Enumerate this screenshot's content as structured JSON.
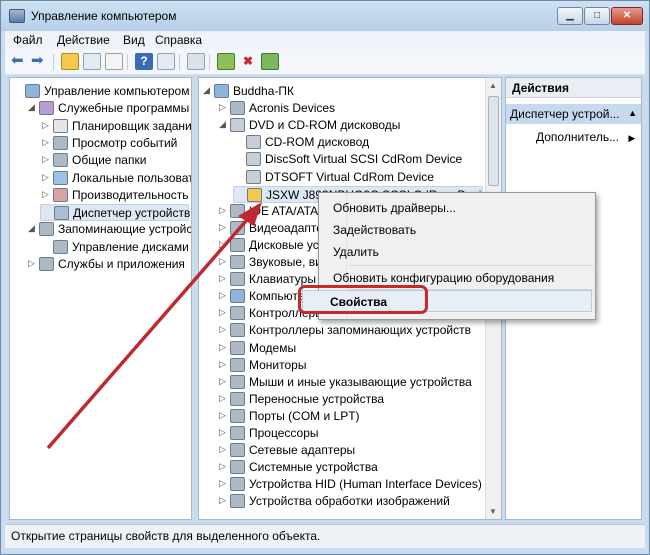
{
  "window": {
    "title": "Управление компьютером"
  },
  "menu": [
    "Файл",
    "Действие",
    "Вид",
    "Справка"
  ],
  "left_tree": [
    {
      "label": "Управление компьютером (л",
      "depth": 0,
      "exp": "",
      "icon": "computer-icon"
    },
    {
      "label": "Служебные программы",
      "depth": 1,
      "exp": "◢",
      "icon": "tools-icon"
    },
    {
      "label": "Планировщик заданий",
      "depth": 2,
      "exp": "▷",
      "icon": "clock-icon"
    },
    {
      "label": "Просмотр событий",
      "depth": 2,
      "exp": "▷",
      "icon": "event-viewer-icon"
    },
    {
      "label": "Общие папки",
      "depth": 2,
      "exp": "▷",
      "icon": "shared-folders-icon"
    },
    {
      "label": "Локальные пользовате",
      "depth": 2,
      "exp": "▷",
      "icon": "users-icon"
    },
    {
      "label": "Производительность",
      "depth": 2,
      "exp": "▷",
      "icon": "performance-icon"
    },
    {
      "label": "Диспетчер устройств",
      "depth": 2,
      "exp": "",
      "icon": "device-manager-icon",
      "selected": true
    },
    {
      "label": "Запоминающие устройства",
      "depth": 1,
      "exp": "◢",
      "icon": "storage-icon"
    },
    {
      "label": "Управление дисками",
      "depth": 2,
      "exp": "",
      "icon": "disk-management-icon"
    },
    {
      "label": "Службы и приложения",
      "depth": 1,
      "exp": "▷",
      "icon": "services-icon"
    }
  ],
  "device_tree": [
    {
      "label": "Buddha-ПК",
      "depth": 0,
      "exp": "◢",
      "icon": "computer-icon"
    },
    {
      "label": "Acronis Devices",
      "depth": 1,
      "exp": "▷",
      "icon": "device-icon"
    },
    {
      "label": "DVD и CD-ROM дисководы",
      "depth": 1,
      "exp": "◢",
      "icon": "dvd-drive-icon"
    },
    {
      "label": "CD-ROM дисковод",
      "depth": 2,
      "exp": "",
      "icon": "dvd-drive-icon"
    },
    {
      "label": "DiscSoft Virtual SCSI CdRom Device",
      "depth": 2,
      "exp": "",
      "icon": "dvd-drive-icon"
    },
    {
      "label": "DTSOFT Virtual CdRom Device",
      "depth": 2,
      "exp": "",
      "icon": "dvd-drive-icon"
    },
    {
      "label": "JSXW J893NBHO2C SCSI CdRom Device",
      "depth": 2,
      "exp": "",
      "icon": "warning-drive-icon",
      "selected": true
    },
    {
      "label": "IDE ATA/ATAPI контроллеры",
      "depth": 1,
      "exp": "▷",
      "icon": "controller-icon"
    },
    {
      "label": "Видеоадаптеры",
      "depth": 1,
      "exp": "▷",
      "icon": "display-adapter-icon"
    },
    {
      "label": "Дисковые устройства",
      "depth": 1,
      "exp": "▷",
      "icon": "disk-drive-icon"
    },
    {
      "label": "Звуковые, видео и игровые устройства",
      "depth": 1,
      "exp": "▷",
      "icon": "sound-icon"
    },
    {
      "label": "Клавиатуры",
      "depth": 1,
      "exp": "▷",
      "icon": "keyboard-icon"
    },
    {
      "label": "Компьютер",
      "depth": 1,
      "exp": "▷",
      "icon": "computer-icon"
    },
    {
      "label": "Контроллеры USB",
      "depth": 1,
      "exp": "▷",
      "icon": "usb-icon"
    },
    {
      "label": "Контроллеры запоминающих устройств",
      "depth": 1,
      "exp": "▷",
      "icon": "storage-controller-icon"
    },
    {
      "label": "Модемы",
      "depth": 1,
      "exp": "▷",
      "icon": "modem-icon"
    },
    {
      "label": "Мониторы",
      "depth": 1,
      "exp": "▷",
      "icon": "monitor-icon"
    },
    {
      "label": "Мыши и иные указывающие устройства",
      "depth": 1,
      "exp": "▷",
      "icon": "mouse-icon"
    },
    {
      "label": "Переносные устройства",
      "depth": 1,
      "exp": "▷",
      "icon": "portable-device-icon"
    },
    {
      "label": "Порты (COM и LPT)",
      "depth": 1,
      "exp": "▷",
      "icon": "port-icon"
    },
    {
      "label": "Процессоры",
      "depth": 1,
      "exp": "▷",
      "icon": "processor-icon"
    },
    {
      "label": "Сетевые адаптеры",
      "depth": 1,
      "exp": "▷",
      "icon": "network-adapter-icon"
    },
    {
      "label": "Системные устройства",
      "depth": 1,
      "exp": "▷",
      "icon": "system-device-icon"
    },
    {
      "label": "Устройства HID (Human Interface Devices)",
      "depth": 1,
      "exp": "▷",
      "icon": "hid-icon"
    },
    {
      "label": "Устройства обработки изображений",
      "depth": 1,
      "exp": "▷",
      "icon": "imaging-device-icon"
    }
  ],
  "actions": {
    "header": "Действия",
    "subheader": "Диспетчер устрой...",
    "more": "Дополнитель..."
  },
  "context_menu": {
    "update": "Обновить драйверы...",
    "enable": "Задействовать",
    "delete": "Удалить",
    "scan": "Обновить конфигурацию оборудования",
    "properties": "Свойства"
  },
  "status": "Открытие страницы свойств для выделенного объекта.",
  "colors": {
    "highlight": "#c52b2b",
    "arrow": "#c0282f",
    "window_frame": "#c9dcef"
  }
}
